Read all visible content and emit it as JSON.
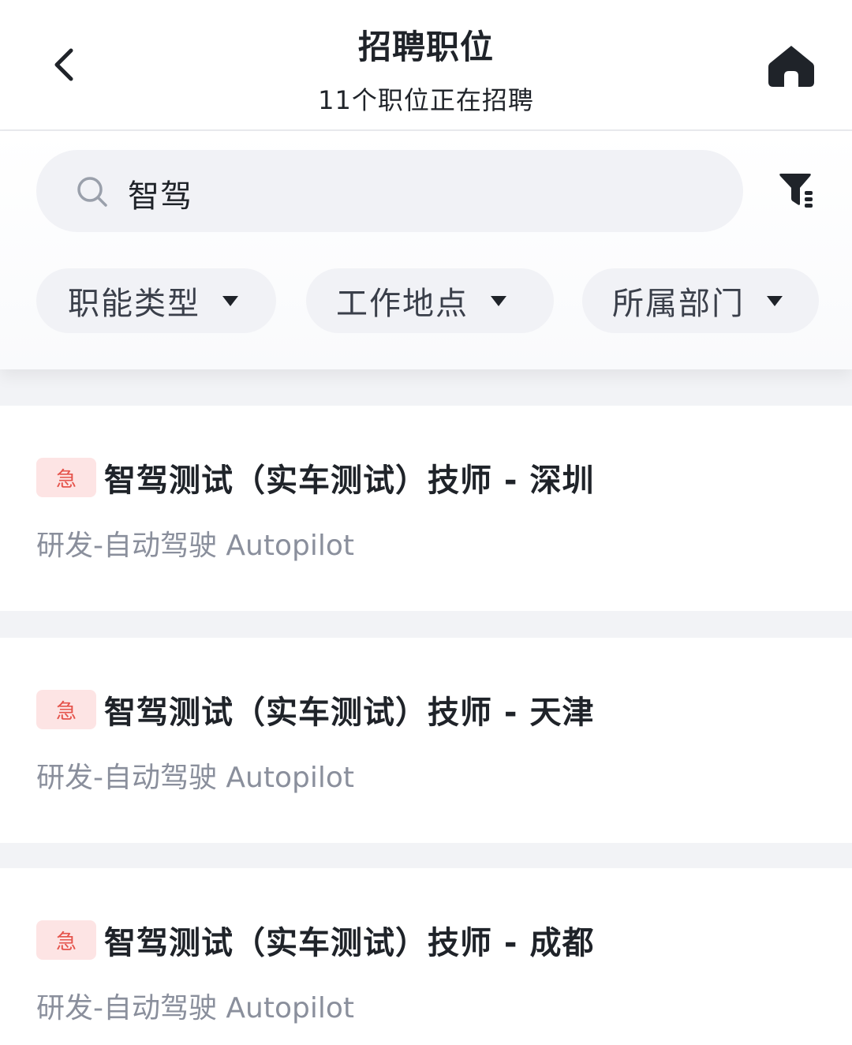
{
  "header": {
    "title": "招聘职位",
    "subtitle": "11个职位正在招聘"
  },
  "search": {
    "value": "智驾"
  },
  "filters": [
    {
      "label": "职能类型"
    },
    {
      "label": "工作地点"
    },
    {
      "label": "所属部门"
    }
  ],
  "jobs": [
    {
      "badge": "急",
      "title": "智驾测试（实车测试）技师 - 深圳",
      "department": "研发-自动驾驶 Autopilot"
    },
    {
      "badge": "急",
      "title": "智驾测试（实车测试）技师 - 天津",
      "department": "研发-自动驾驶 Autopilot"
    },
    {
      "badge": "急",
      "title": "智驾测试（实车测试）技师 - 成都",
      "department": "研发-自动驾驶 Autopilot"
    }
  ],
  "icons": {
    "back": "chevron-left-icon",
    "home": "home-icon",
    "search": "search-icon",
    "filter": "filter-icon",
    "caret": "caret-down-icon"
  },
  "colors": {
    "urgent_text": "#e5534b",
    "urgent_bg": "#fde4e4",
    "secondary_text": "#8a8f9c"
  }
}
